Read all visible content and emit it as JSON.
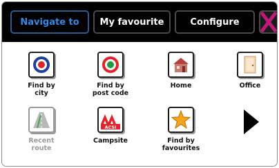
{
  "tabs": {
    "navigate_to": "Navigate to",
    "my_favourite": "My favourite",
    "configure": "Configure"
  },
  "items": [
    {
      "label": "Find by\ncity",
      "icon": "target-icon"
    },
    {
      "label": "Find by\npost code",
      "icon": "target-green-icon"
    },
    {
      "label": "Home",
      "icon": "house-icon"
    },
    {
      "label": "Office",
      "icon": "door-icon"
    },
    {
      "label": "Recent\nroute",
      "icon": "road-icon",
      "disabled": true
    },
    {
      "label": "Campsite",
      "icon": "campsite-icon",
      "badge": "ACSI"
    },
    {
      "label": "Find by\nfavourites",
      "icon": "star-icon"
    }
  ],
  "colors": {
    "active_tab": "#2f8be6",
    "close": "#c0197a",
    "disabled_label": "#9a9a9a"
  }
}
